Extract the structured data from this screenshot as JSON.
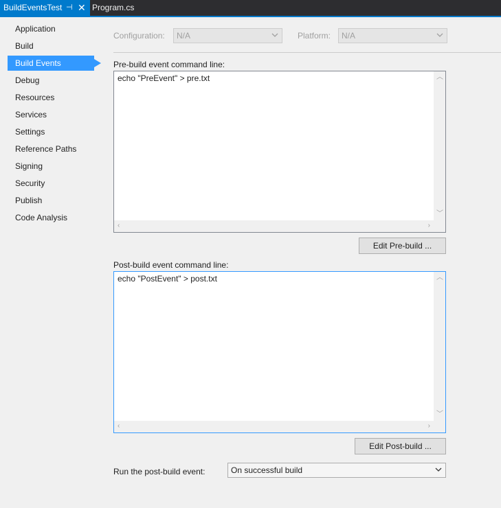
{
  "tabs": {
    "active": "BuildEventsTest",
    "pin_glyph": "⊣",
    "close_glyph": "✕",
    "inactive": "Program.cs"
  },
  "sidebar": {
    "items": [
      {
        "label": "Application"
      },
      {
        "label": "Build"
      },
      {
        "label": "Build Events",
        "selected": true
      },
      {
        "label": "Debug"
      },
      {
        "label": "Resources"
      },
      {
        "label": "Services"
      },
      {
        "label": "Settings"
      },
      {
        "label": "Reference Paths"
      },
      {
        "label": "Signing"
      },
      {
        "label": "Security"
      },
      {
        "label": "Publish"
      },
      {
        "label": "Code Analysis"
      }
    ]
  },
  "config": {
    "configuration_label": "Configuration:",
    "configuration_value": "N/A",
    "platform_label": "Platform:",
    "platform_value": "N/A"
  },
  "prebuild": {
    "label": "Pre-build event command line:",
    "text": "echo \"PreEvent\" > pre.txt",
    "button": "Edit Pre-build ..."
  },
  "postbuild": {
    "label": "Post-build event command line:",
    "text": "echo \"PostEvent\" > post.txt",
    "button": "Edit Post-build ..."
  },
  "run_event": {
    "label": "Run the post-build event:",
    "value": "On successful build"
  },
  "colors": {
    "accent": "#007acc",
    "selected": "#3399ff",
    "tabstrip": "#2d2d30",
    "background": "#f0f0f0"
  }
}
